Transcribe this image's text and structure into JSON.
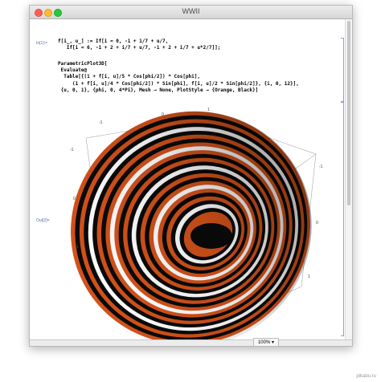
{
  "window": {
    "title": "WWII"
  },
  "cells": {
    "in_label": "In[1]:=",
    "out_label": "Out[2]=",
    "definition_lines": [
      "f[i_, u_] := If[i ≈ 0, -1 + 1/7 + u/7,",
      "   If[i ≈ 6, -1 + 2 + i/7 + u/7, -1 + 2 + i/7 + u*2/7]];"
    ],
    "plot_lines": [
      "ParametricPlot3D[",
      " Evaluate@",
      "  Table[{(1 + f[i, u]/5 * Cos[phi/2]) * Cos[phi],",
      "     (1 + f[i, u]/4 * Cos[phi/2]) * Sin[phi], f[i, u]/2 * Sin[phi/2]}, {i, 0, 12}],",
      " {u, 0, 1}, {phi, 0, 4*Pi}, Mesh → None, PlotStyle → {Orange, Black}]"
    ]
  },
  "plot": {
    "tick_labels": [
      "-1",
      "0",
      "1",
      "-1",
      "0",
      "1",
      "-1",
      "0",
      "1"
    ],
    "colors": {
      "band_a": "#d4521a",
      "band_b": "#0a0a0a",
      "box": "#9a9a9a"
    }
  },
  "statusbar": {
    "zoom": "100%",
    "zoom_arrow": "▾"
  },
  "watermark": "pikabu.ru"
}
